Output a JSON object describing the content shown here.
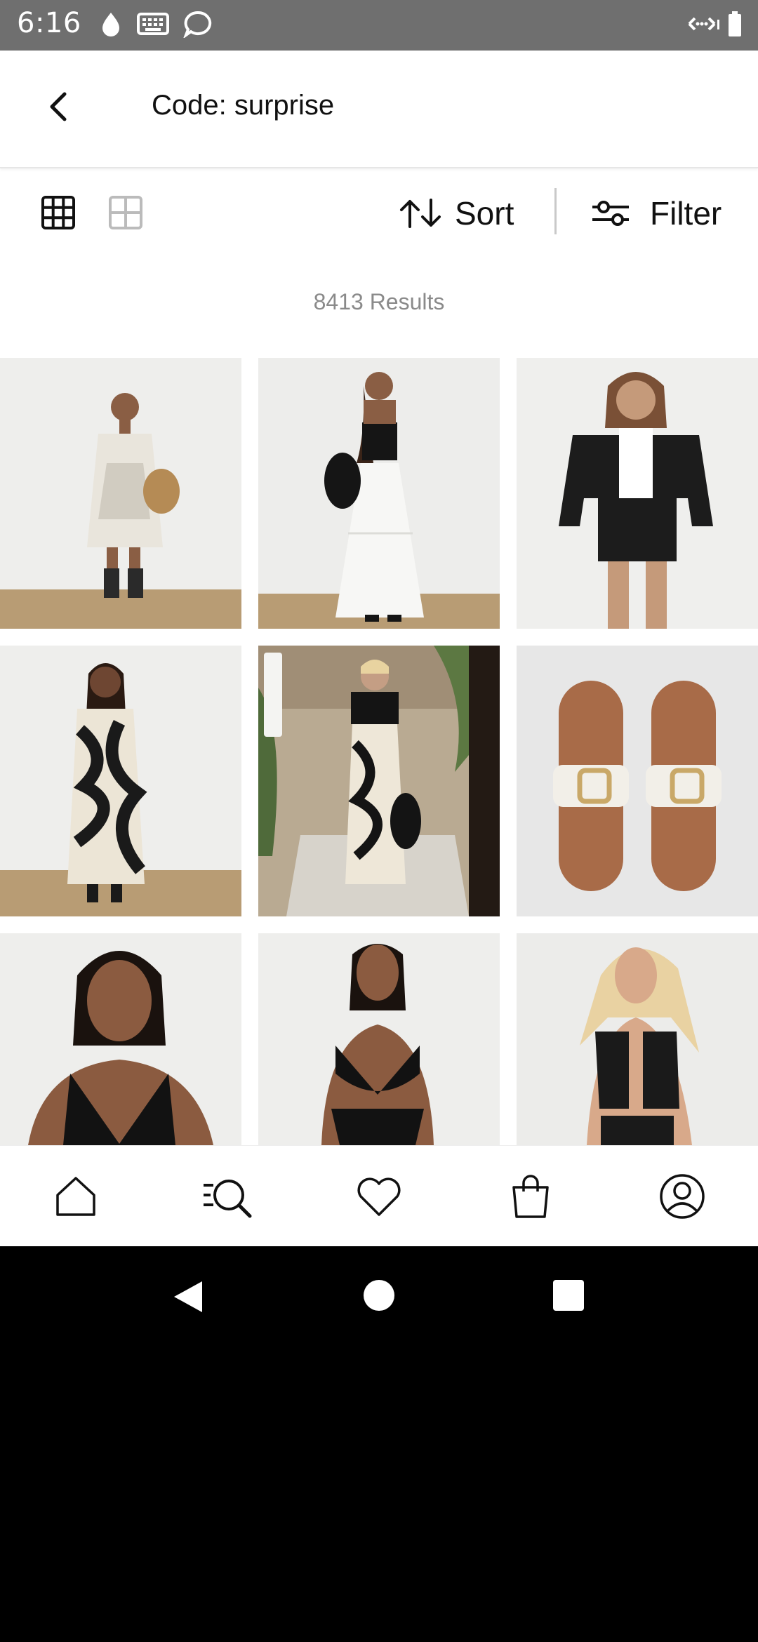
{
  "status_bar": {
    "time": "6:16",
    "left_icons": [
      "water-drop-icon",
      "keyboard-icon",
      "chat-bubble-icon"
    ],
    "right_icons": [
      "wifi-calling-icon",
      "battery-icon"
    ]
  },
  "header": {
    "title": "Code: surprise",
    "back_icon": "chevron-left-icon"
  },
  "toolbar": {
    "grid_view_3": "grid-3x3-icon",
    "grid_view_2": "grid-2x2-icon",
    "sort_label": "Sort",
    "filter_label": "Filter"
  },
  "results_text": "8413 Results",
  "products": [
    {
      "name": "white embroidered mini dress",
      "colors": {
        "bg": "#eeeeec",
        "floor": "#b89c74",
        "outfit": "#e9e5dc",
        "accent": "#2a2a2a"
      }
    },
    {
      "name": "white tiered maxi skirt",
      "colors": {
        "bg": "#ededeb",
        "floor": "#b89c74",
        "outfit": "#f7f7f5",
        "accent": "#151515"
      }
    },
    {
      "name": "black denim jacket and shorts",
      "colors": {
        "bg": "#efefed",
        "floor": "#efefed",
        "outfit": "#1c1c1c",
        "accent": "#ffffff"
      }
    },
    {
      "name": "black and white swirl print maxi dress",
      "colors": {
        "bg": "#eeeeec",
        "floor": "#b89c74",
        "outfit": "#ece5d6",
        "accent": "#1a1a1a"
      }
    },
    {
      "name": "swirl print skirt outdoor",
      "colors": {
        "bg": "#b9aa92",
        "floor": "#d7d3cb",
        "outfit": "#eee7d8",
        "accent": "#141414"
      }
    },
    {
      "name": "white buckle sliders",
      "colors": {
        "bg": "#e7e7e7",
        "floor": "#e7e7e7",
        "outfit": "#a86b48",
        "accent": "#f2efe8"
      }
    },
    {
      "name": "black halter swimsuit",
      "colors": {
        "bg": "#eeeeec",
        "floor": "#eeeeec",
        "outfit": "#121212",
        "accent": "#8b5b40"
      }
    },
    {
      "name": "black bikini set",
      "colors": {
        "bg": "#eeeeec",
        "floor": "#eeeeec",
        "outfit": "#121212",
        "accent": "#8b5b40"
      }
    },
    {
      "name": "black crochet waistcoat",
      "colors": {
        "bg": "#ececea",
        "floor": "#ececea",
        "outfit": "#1a1a1a",
        "accent": "#e9d2a2"
      }
    }
  ],
  "bottom_nav": [
    "home-icon",
    "search-list-icon",
    "heart-icon",
    "bag-icon",
    "profile-icon"
  ]
}
